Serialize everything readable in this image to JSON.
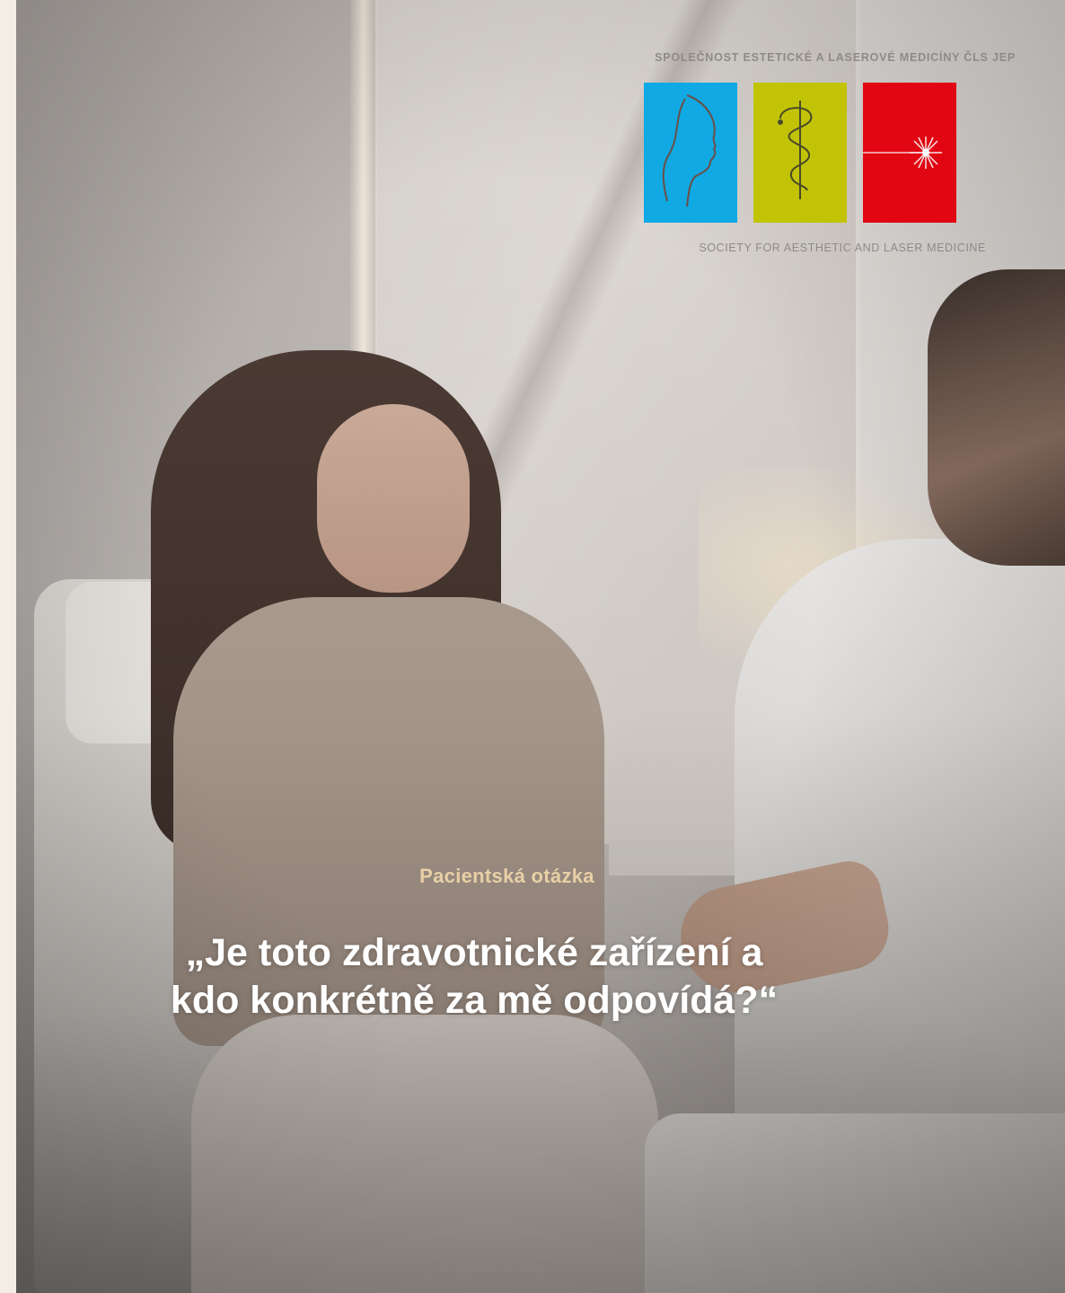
{
  "logo": {
    "top_text": "SPOLEČNOST ESTETICKÉ A LASEROVÉ MEDICÍNY ČLS JEP",
    "bottom_text": "SOCIETY FOR AESTHETIC AND LASER MEDICINE",
    "colors": {
      "blue": "#10a9e4",
      "lime": "#c2c305",
      "red": "#e20613"
    },
    "icons": [
      "face-profile-icon",
      "caduceus-icon",
      "laser-icon"
    ]
  },
  "kicker": "Pacientská otázka",
  "headline": {
    "line1": "„Je toto zdravotnické zařízení a",
    "line2": "kdo konkrétně za mě odpovídá?“"
  },
  "colors": {
    "kicker": "#e8cfa6",
    "headline": "#ffffff",
    "page_background": "#f3ece4"
  }
}
